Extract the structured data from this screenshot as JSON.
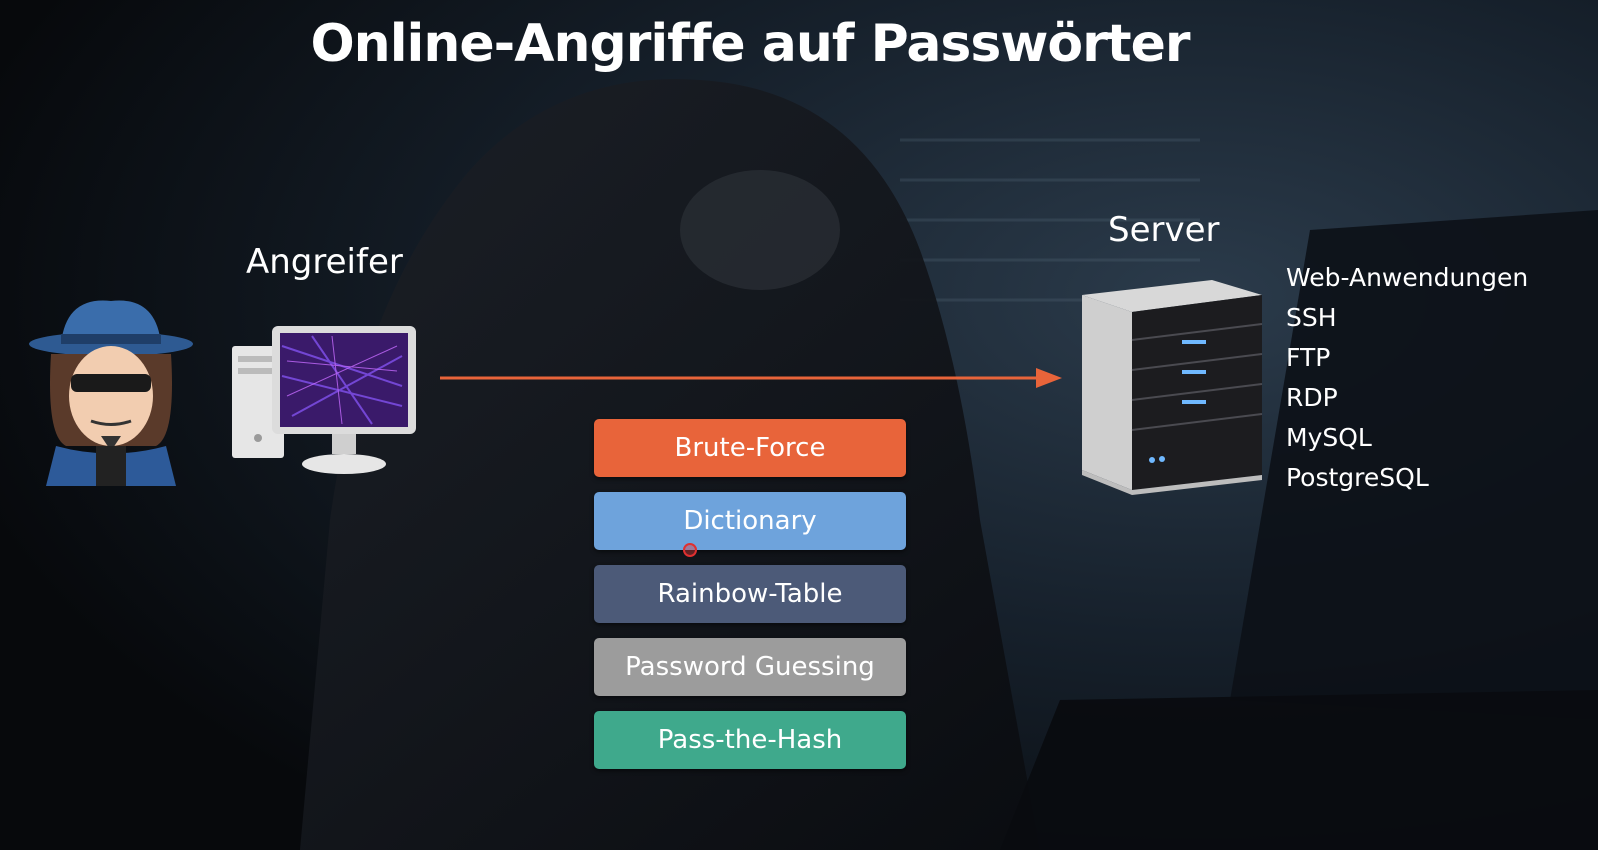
{
  "title": "Online-Angriffe auf Passwörter",
  "attacker": {
    "label": "Angreifer"
  },
  "server": {
    "label": "Server",
    "services": [
      "Web-Anwendungen",
      "SSH",
      "FTP",
      "RDP",
      "MySQL",
      "PostgreSQL"
    ]
  },
  "methods": [
    {
      "label": "Brute-Force",
      "color": "#e8643a"
    },
    {
      "label": "Dictionary",
      "color": "#6ea3dc"
    },
    {
      "label": "Rainbow-Table",
      "color": "#4c5a78"
    },
    {
      "label": "Password Guessing",
      "color": "#9c9c9c"
    },
    {
      "label": "Pass-the-Hash",
      "color": "#3fa98c"
    }
  ],
  "colors": {
    "arrow": "#e8643a",
    "background": "#0b0f14"
  },
  "icons": [
    "hacker-avatar-icon",
    "computer-icon",
    "server-icon",
    "arrow-right-icon"
  ]
}
